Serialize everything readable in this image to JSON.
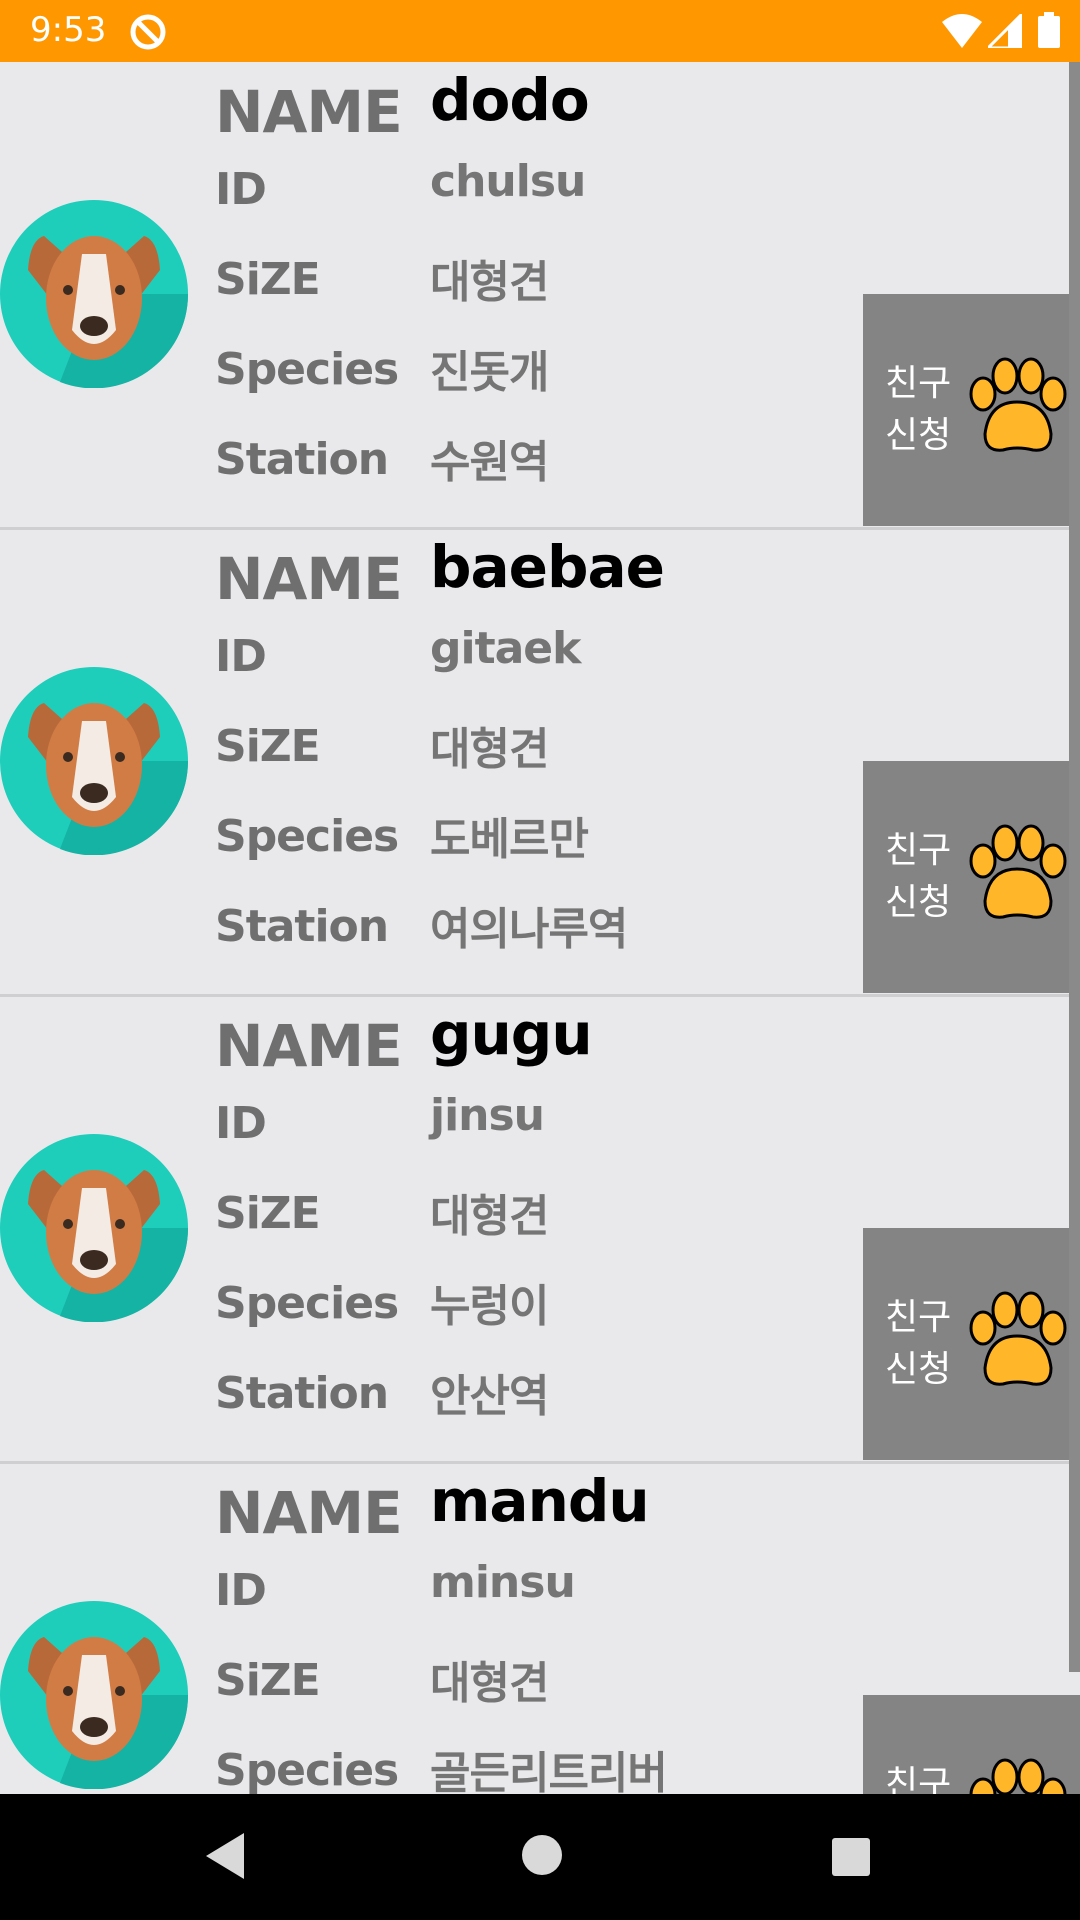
{
  "status": {
    "time": "9:53",
    "icons": [
      "sync-icon",
      "wifi-icon",
      "signal-icon",
      "battery-icon"
    ]
  },
  "labels": {
    "name": "NAME",
    "id": "ID",
    "size": "SiZE",
    "species": "Species",
    "station": "Station"
  },
  "friend_button": {
    "line1": "친구",
    "line2": "신청"
  },
  "dogs": [
    {
      "name": "dodo",
      "id": "chulsu",
      "size": "대형견",
      "species": "진돗개",
      "station": "수원역"
    },
    {
      "name": "baebae",
      "id": "gitaek",
      "size": "대형견",
      "species": "도베르만",
      "station": "여의나루역"
    },
    {
      "name": "gugu",
      "id": "jinsu",
      "size": "대형견",
      "species": "누렁이",
      "station": "안산역"
    },
    {
      "name": "mandu",
      "id": "minsu",
      "size": "대형견",
      "species": "골든리트리버",
      "station": ""
    }
  ],
  "colors": {
    "status_bar": "#ff9800",
    "background": "#e9e9ec",
    "friend_button": "#848484",
    "paw": "#ffb628",
    "avatar_bg": "#1fcdbb"
  },
  "nav": [
    "back-icon",
    "home-icon",
    "recents-icon"
  ]
}
